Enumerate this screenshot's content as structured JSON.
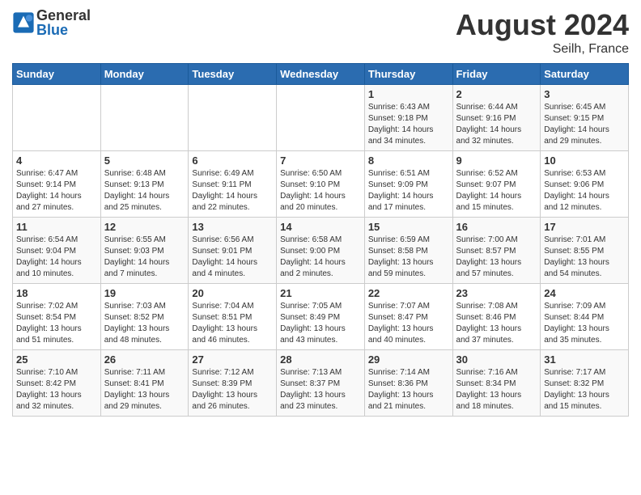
{
  "header": {
    "logo_general": "General",
    "logo_blue": "Blue",
    "month_title": "August 2024",
    "location": "Seilh, France"
  },
  "days_of_week": [
    "Sunday",
    "Monday",
    "Tuesday",
    "Wednesday",
    "Thursday",
    "Friday",
    "Saturday"
  ],
  "weeks": [
    [
      {
        "day": "",
        "info": ""
      },
      {
        "day": "",
        "info": ""
      },
      {
        "day": "",
        "info": ""
      },
      {
        "day": "",
        "info": ""
      },
      {
        "day": "1",
        "info": "Sunrise: 6:43 AM\nSunset: 9:18 PM\nDaylight: 14 hours\nand 34 minutes."
      },
      {
        "day": "2",
        "info": "Sunrise: 6:44 AM\nSunset: 9:16 PM\nDaylight: 14 hours\nand 32 minutes."
      },
      {
        "day": "3",
        "info": "Sunrise: 6:45 AM\nSunset: 9:15 PM\nDaylight: 14 hours\nand 29 minutes."
      }
    ],
    [
      {
        "day": "4",
        "info": "Sunrise: 6:47 AM\nSunset: 9:14 PM\nDaylight: 14 hours\nand 27 minutes."
      },
      {
        "day": "5",
        "info": "Sunrise: 6:48 AM\nSunset: 9:13 PM\nDaylight: 14 hours\nand 25 minutes."
      },
      {
        "day": "6",
        "info": "Sunrise: 6:49 AM\nSunset: 9:11 PM\nDaylight: 14 hours\nand 22 minutes."
      },
      {
        "day": "7",
        "info": "Sunrise: 6:50 AM\nSunset: 9:10 PM\nDaylight: 14 hours\nand 20 minutes."
      },
      {
        "day": "8",
        "info": "Sunrise: 6:51 AM\nSunset: 9:09 PM\nDaylight: 14 hours\nand 17 minutes."
      },
      {
        "day": "9",
        "info": "Sunrise: 6:52 AM\nSunset: 9:07 PM\nDaylight: 14 hours\nand 15 minutes."
      },
      {
        "day": "10",
        "info": "Sunrise: 6:53 AM\nSunset: 9:06 PM\nDaylight: 14 hours\nand 12 minutes."
      }
    ],
    [
      {
        "day": "11",
        "info": "Sunrise: 6:54 AM\nSunset: 9:04 PM\nDaylight: 14 hours\nand 10 minutes."
      },
      {
        "day": "12",
        "info": "Sunrise: 6:55 AM\nSunset: 9:03 PM\nDaylight: 14 hours\nand 7 minutes."
      },
      {
        "day": "13",
        "info": "Sunrise: 6:56 AM\nSunset: 9:01 PM\nDaylight: 14 hours\nand 4 minutes."
      },
      {
        "day": "14",
        "info": "Sunrise: 6:58 AM\nSunset: 9:00 PM\nDaylight: 14 hours\nand 2 minutes."
      },
      {
        "day": "15",
        "info": "Sunrise: 6:59 AM\nSunset: 8:58 PM\nDaylight: 13 hours\nand 59 minutes."
      },
      {
        "day": "16",
        "info": "Sunrise: 7:00 AM\nSunset: 8:57 PM\nDaylight: 13 hours\nand 57 minutes."
      },
      {
        "day": "17",
        "info": "Sunrise: 7:01 AM\nSunset: 8:55 PM\nDaylight: 13 hours\nand 54 minutes."
      }
    ],
    [
      {
        "day": "18",
        "info": "Sunrise: 7:02 AM\nSunset: 8:54 PM\nDaylight: 13 hours\nand 51 minutes."
      },
      {
        "day": "19",
        "info": "Sunrise: 7:03 AM\nSunset: 8:52 PM\nDaylight: 13 hours\nand 48 minutes."
      },
      {
        "day": "20",
        "info": "Sunrise: 7:04 AM\nSunset: 8:51 PM\nDaylight: 13 hours\nand 46 minutes."
      },
      {
        "day": "21",
        "info": "Sunrise: 7:05 AM\nSunset: 8:49 PM\nDaylight: 13 hours\nand 43 minutes."
      },
      {
        "day": "22",
        "info": "Sunrise: 7:07 AM\nSunset: 8:47 PM\nDaylight: 13 hours\nand 40 minutes."
      },
      {
        "day": "23",
        "info": "Sunrise: 7:08 AM\nSunset: 8:46 PM\nDaylight: 13 hours\nand 37 minutes."
      },
      {
        "day": "24",
        "info": "Sunrise: 7:09 AM\nSunset: 8:44 PM\nDaylight: 13 hours\nand 35 minutes."
      }
    ],
    [
      {
        "day": "25",
        "info": "Sunrise: 7:10 AM\nSunset: 8:42 PM\nDaylight: 13 hours\nand 32 minutes."
      },
      {
        "day": "26",
        "info": "Sunrise: 7:11 AM\nSunset: 8:41 PM\nDaylight: 13 hours\nand 29 minutes."
      },
      {
        "day": "27",
        "info": "Sunrise: 7:12 AM\nSunset: 8:39 PM\nDaylight: 13 hours\nand 26 minutes."
      },
      {
        "day": "28",
        "info": "Sunrise: 7:13 AM\nSunset: 8:37 PM\nDaylight: 13 hours\nand 23 minutes."
      },
      {
        "day": "29",
        "info": "Sunrise: 7:14 AM\nSunset: 8:36 PM\nDaylight: 13 hours\nand 21 minutes."
      },
      {
        "day": "30",
        "info": "Sunrise: 7:16 AM\nSunset: 8:34 PM\nDaylight: 13 hours\nand 18 minutes."
      },
      {
        "day": "31",
        "info": "Sunrise: 7:17 AM\nSunset: 8:32 PM\nDaylight: 13 hours\nand 15 minutes."
      }
    ]
  ]
}
